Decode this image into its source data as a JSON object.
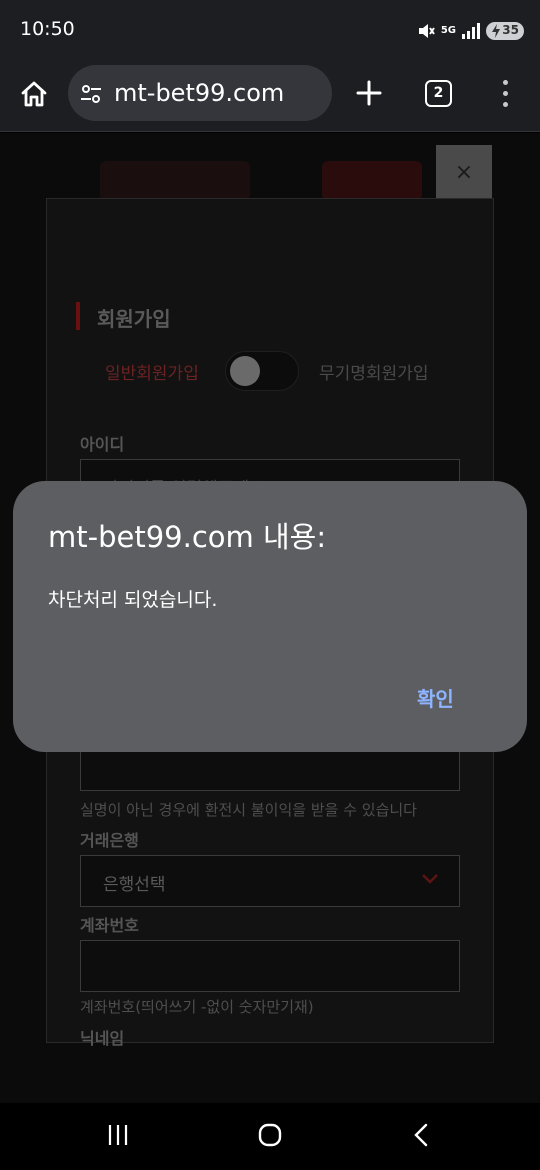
{
  "status_bar": {
    "time": "10:50",
    "network_label": "5G",
    "battery_level": "35",
    "icons": [
      "mute-icon",
      "signal-icon",
      "battery-charging-icon"
    ]
  },
  "browser": {
    "url": "mt-bet99.com",
    "tab_count": "2",
    "icons": [
      "home-icon",
      "site-settings-icon",
      "new-tab-icon",
      "tabs-icon",
      "more-menu-icon"
    ]
  },
  "page": {
    "close_label": "×",
    "form": {
      "title": "회원가입",
      "option_normal": "일반회원가입",
      "option_anonymous": "무기명회원가입",
      "id_label": "아이디",
      "id_placeholder": "아이디를 입력해주세요",
      "name_note": "실명이 아닌 경우에 환전시 불이익을 받을 수 있습니다",
      "bank_label": "거래은행",
      "bank_selected": "은행선택",
      "account_label": "계좌번호",
      "account_note": "계좌번호(띄어쓰기 -없이 숫자만기재)",
      "nickname_label": "닉네임"
    }
  },
  "dialog": {
    "title": "mt-bet99.com 내용:",
    "message": "차단처리 되었습니다.",
    "ok_label": "확인"
  },
  "colors": {
    "dialog_bg": "#5d5e62",
    "ok_button": "#8fb4ff",
    "toolbar_bg": "#1d1e22",
    "accent_red": "#6a1010"
  },
  "nav_bar": {
    "icons": [
      "recent-apps-icon",
      "home-circle-icon",
      "back-icon"
    ]
  }
}
